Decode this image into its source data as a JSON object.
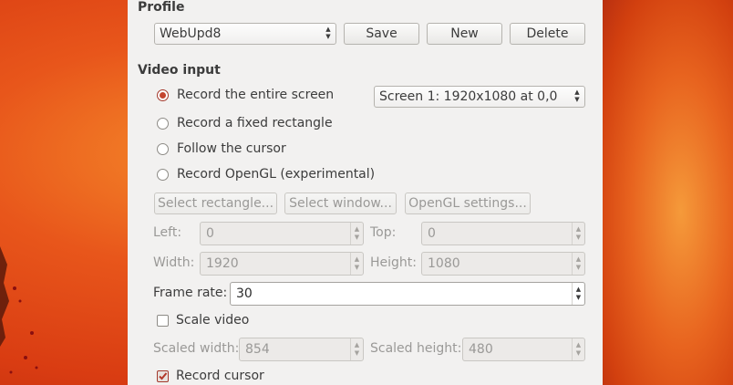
{
  "profile": {
    "section_title": "Profile",
    "selected": "WebUpd8",
    "save_label": "Save",
    "new_label": "New",
    "delete_label": "Delete"
  },
  "video_input": {
    "section_title": "Video input",
    "options": [
      {
        "label": "Record the entire screen",
        "checked": true
      },
      {
        "label": "Record a fixed rectangle",
        "checked": false
      },
      {
        "label": "Follow the cursor",
        "checked": false
      },
      {
        "label": "Record OpenGL (experimental)",
        "checked": false
      }
    ],
    "screen_select": "Screen 1: 1920x1080 at 0,0",
    "select_rectangle_label": "Select rectangle...",
    "select_window_label": "Select window...",
    "opengl_settings_label": "OpenGL settings...",
    "left_label": "Left:",
    "left_value": "0",
    "top_label": "Top:",
    "top_value": "0",
    "width_label": "Width:",
    "width_value": "1920",
    "height_label": "Height:",
    "height_value": "1080",
    "frame_rate_label": "Frame rate:",
    "frame_rate_value": "30",
    "scale_video_label": "Scale video",
    "scale_video_checked": false,
    "scaled_width_label": "Scaled width:",
    "scaled_width_value": "854",
    "scaled_height_label": "Scaled height:",
    "scaled_height_value": "480",
    "record_cursor_label": "Record cursor",
    "record_cursor_checked": true
  },
  "colors": {
    "accent": "#c4452f",
    "panel_bg": "#f2f1f0",
    "wallpaper": "#e8561b"
  }
}
